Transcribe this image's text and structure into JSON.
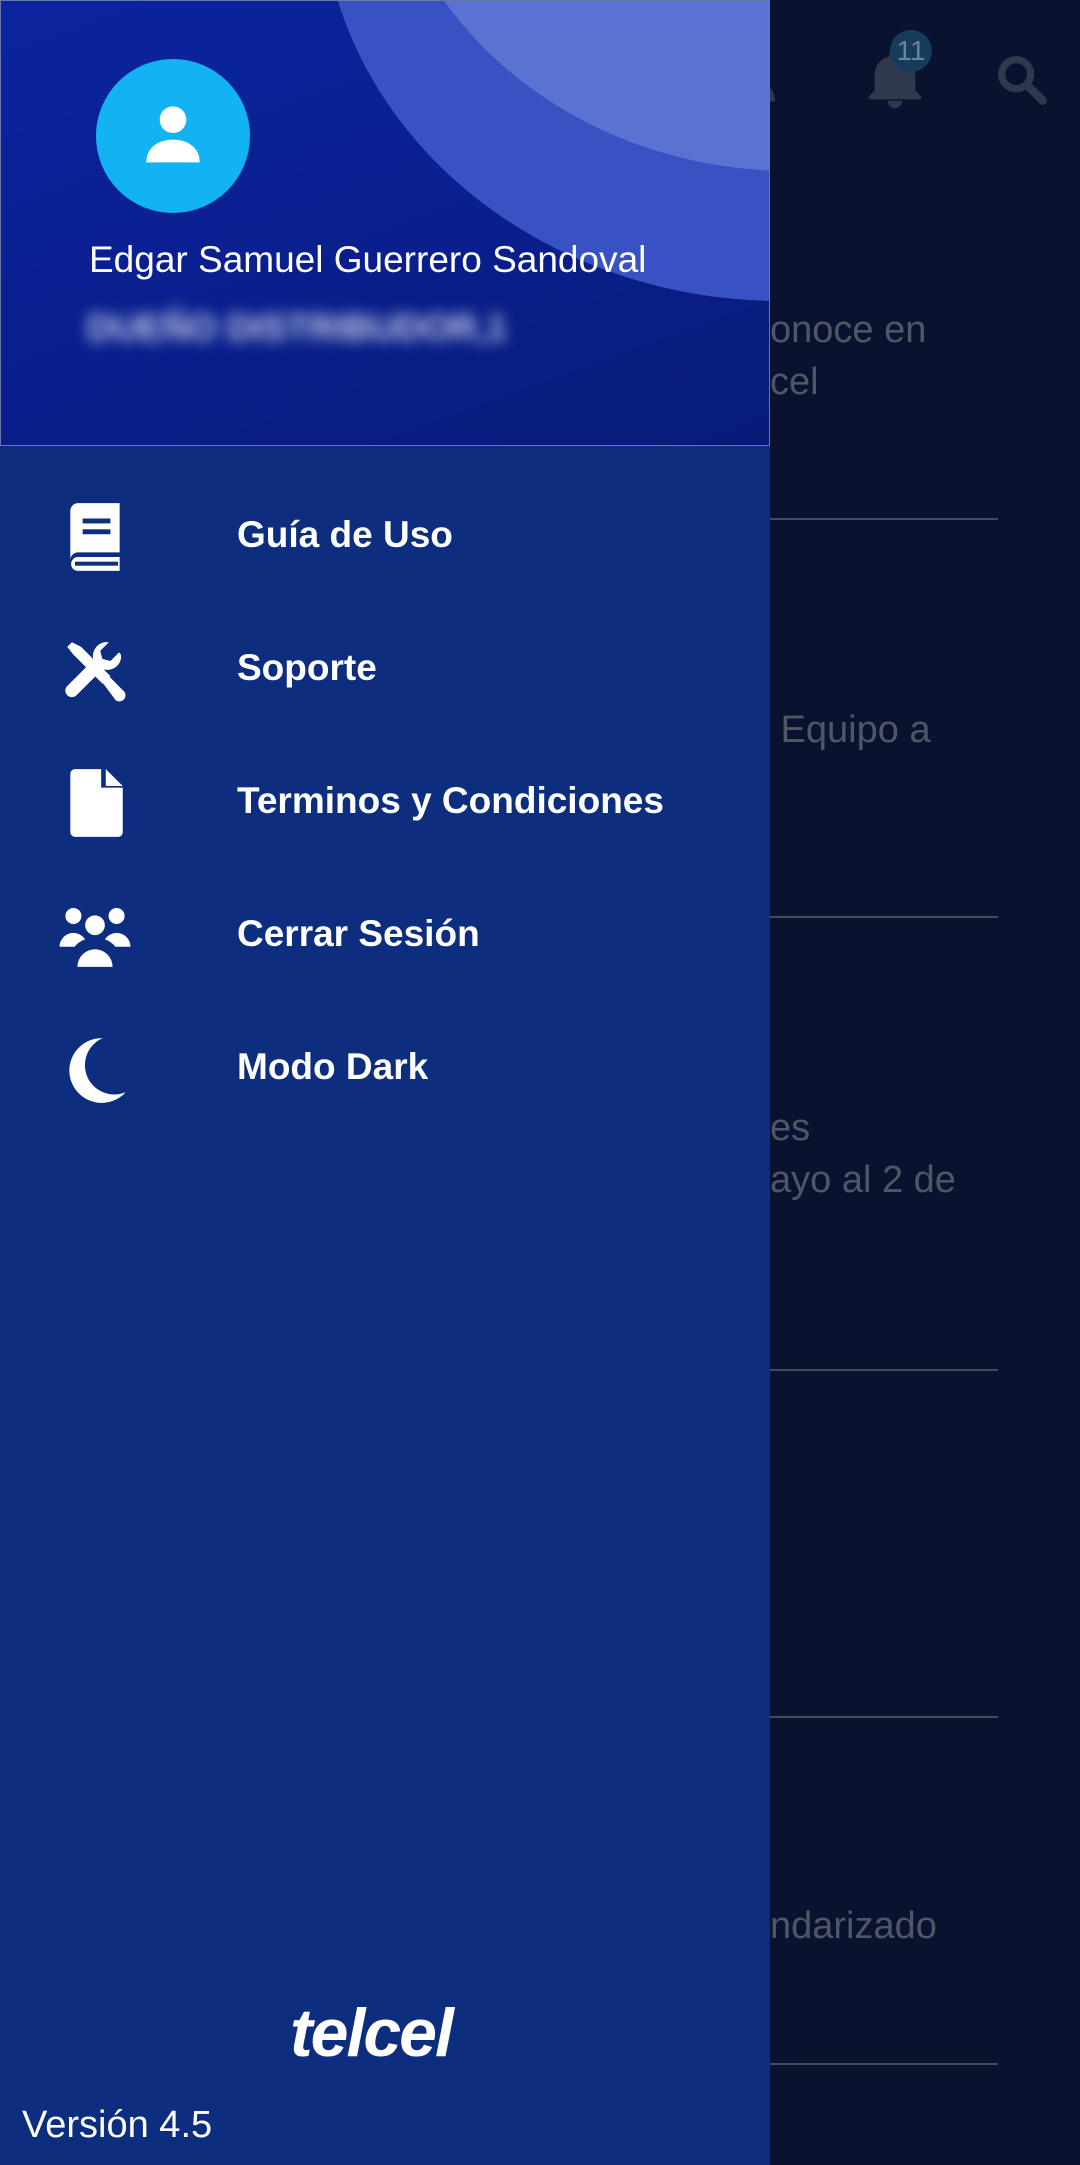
{
  "background": {
    "badge_count": "11",
    "snippets": [
      "onoce en\ncel",
      " Equipo a",
      "es\nayo al 2 de",
      "ndarizado"
    ]
  },
  "drawer": {
    "user": {
      "name": "Edgar Samuel Guerrero Sandoval",
      "role": "DUEÑO DISTRIBUDOR,1"
    },
    "menu": [
      {
        "label": "Guía de Uso",
        "icon": "book-icon"
      },
      {
        "label": "Soporte",
        "icon": "tools-icon"
      },
      {
        "label": "Terminos y Condiciones",
        "icon": "file-icon"
      },
      {
        "label": "Cerrar Sesión",
        "icon": "users-icon"
      },
      {
        "label": "Modo Dark",
        "icon": "moon-icon"
      }
    ],
    "brand": "telcel",
    "version": "Versión 4.5"
  },
  "colors": {
    "drawer_bg": "#0d2d7e",
    "header_bg": "#0a24a0",
    "avatar": "#12b3f3"
  }
}
